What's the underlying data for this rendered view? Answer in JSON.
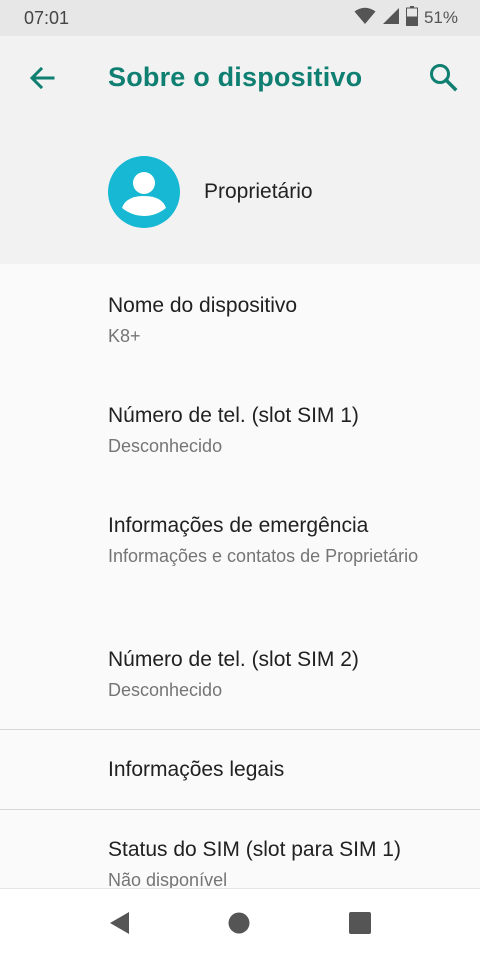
{
  "status_bar": {
    "time": "07:01",
    "battery": "51%",
    "icons": [
      "wifi-icon",
      "signal-icon",
      "battery-icon"
    ]
  },
  "header": {
    "title": "Sobre o dispositivo",
    "back_icon": "back-arrow-icon",
    "search_icon": "search-icon",
    "owner_name": "Proprietário"
  },
  "items": [
    {
      "title": "Nome do dispositivo",
      "subtitle": "K8+"
    },
    {
      "title": "Número de tel. (slot SIM 1)",
      "subtitle": "Desconhecido"
    },
    {
      "title": "Informações de emergência",
      "subtitle": "Informações e contatos de Proprietário"
    },
    {
      "title": "Número de tel. (slot SIM 2)",
      "subtitle": "Desconhecido"
    },
    {
      "title": "Informações legais",
      "subtitle": ""
    },
    {
      "title": "Status do SIM (slot para SIM 1)",
      "subtitle": "Não disponível"
    }
  ],
  "nav": {
    "icons": [
      "back-triangle-icon",
      "home-circle-icon",
      "recents-square-icon"
    ]
  },
  "colors": {
    "accent": "#0f7f72",
    "avatar": "#17b8d3",
    "header_bg": "#f2f2f2",
    "list_bg": "#fafafa"
  }
}
